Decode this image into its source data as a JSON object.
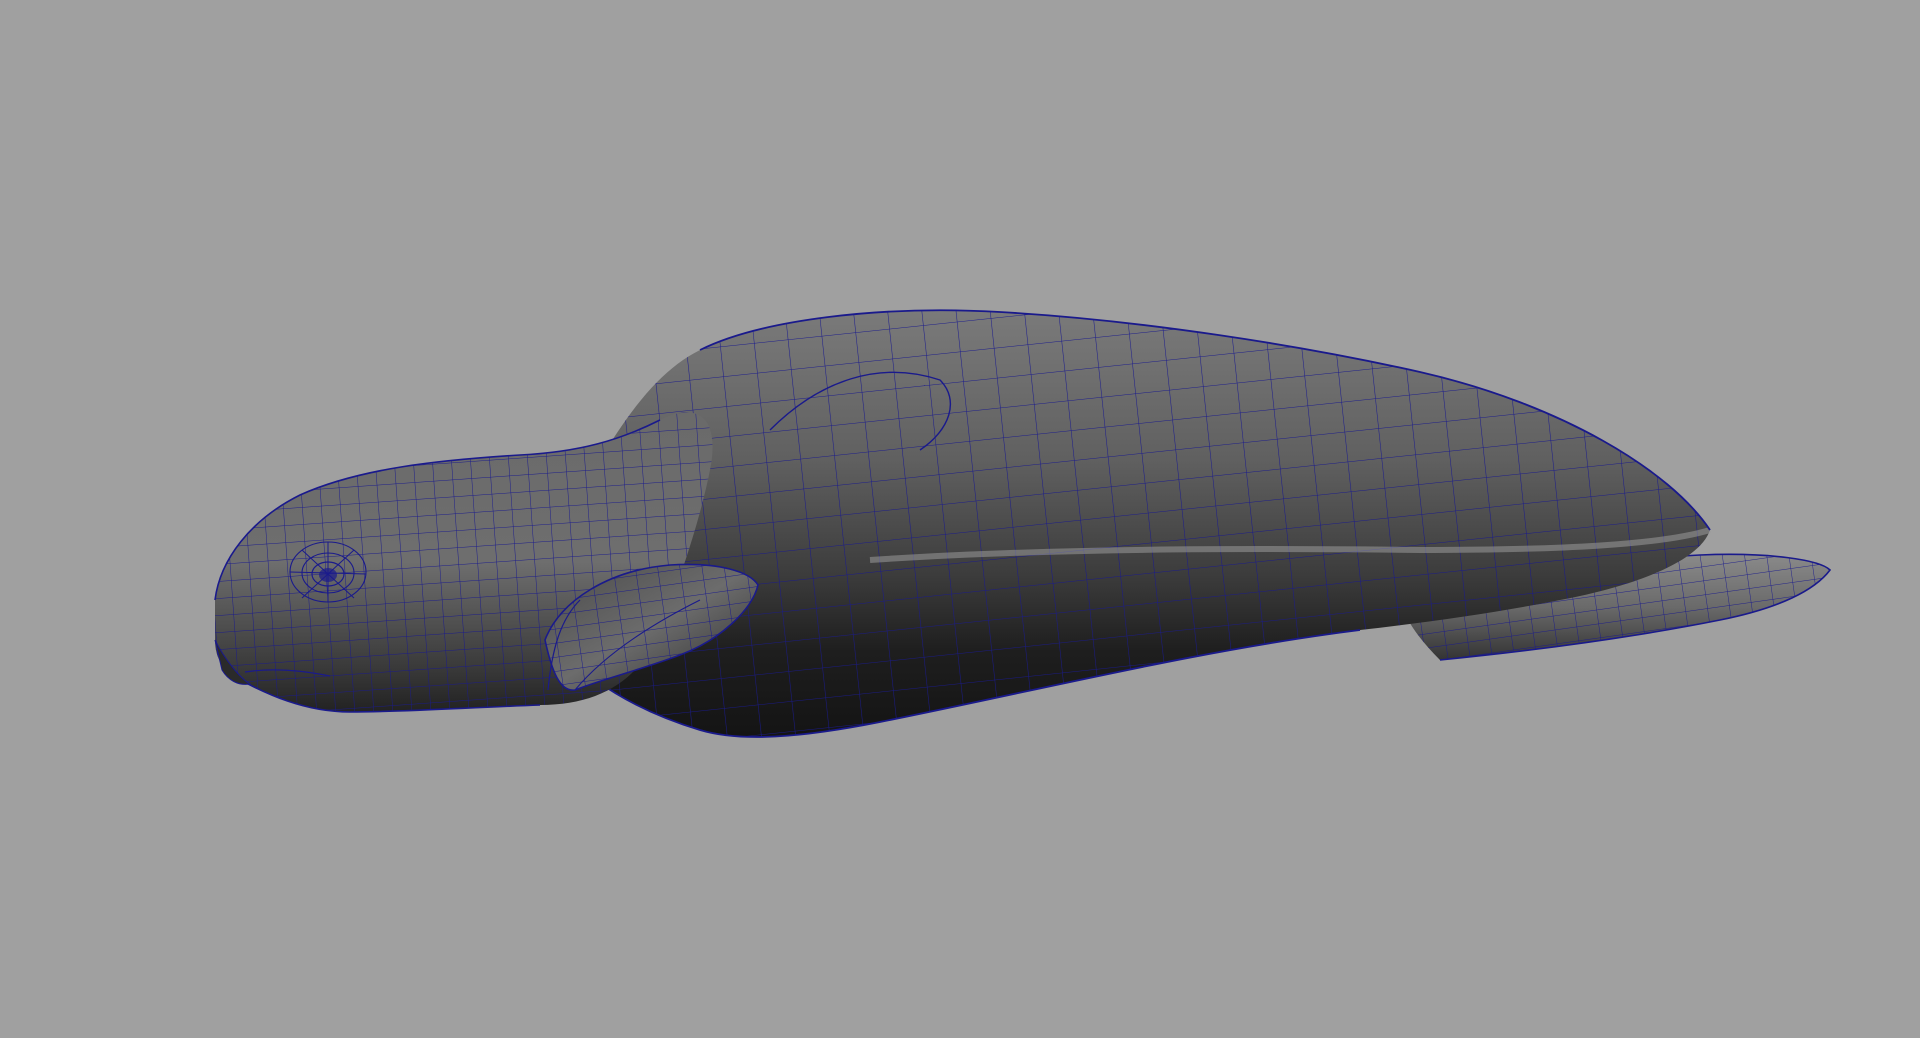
{
  "viewport": {
    "background_color": "#a0a0a0",
    "shading": "smooth-shaded-with-wireframe-on-shaded"
  },
  "model": {
    "subject": "sea-turtle",
    "surface_color": "#5c5c5c",
    "wireframe_color": "#1a1a8c",
    "parts": [
      "head",
      "neck",
      "carapace",
      "front-flipper",
      "rear-flipper"
    ]
  }
}
